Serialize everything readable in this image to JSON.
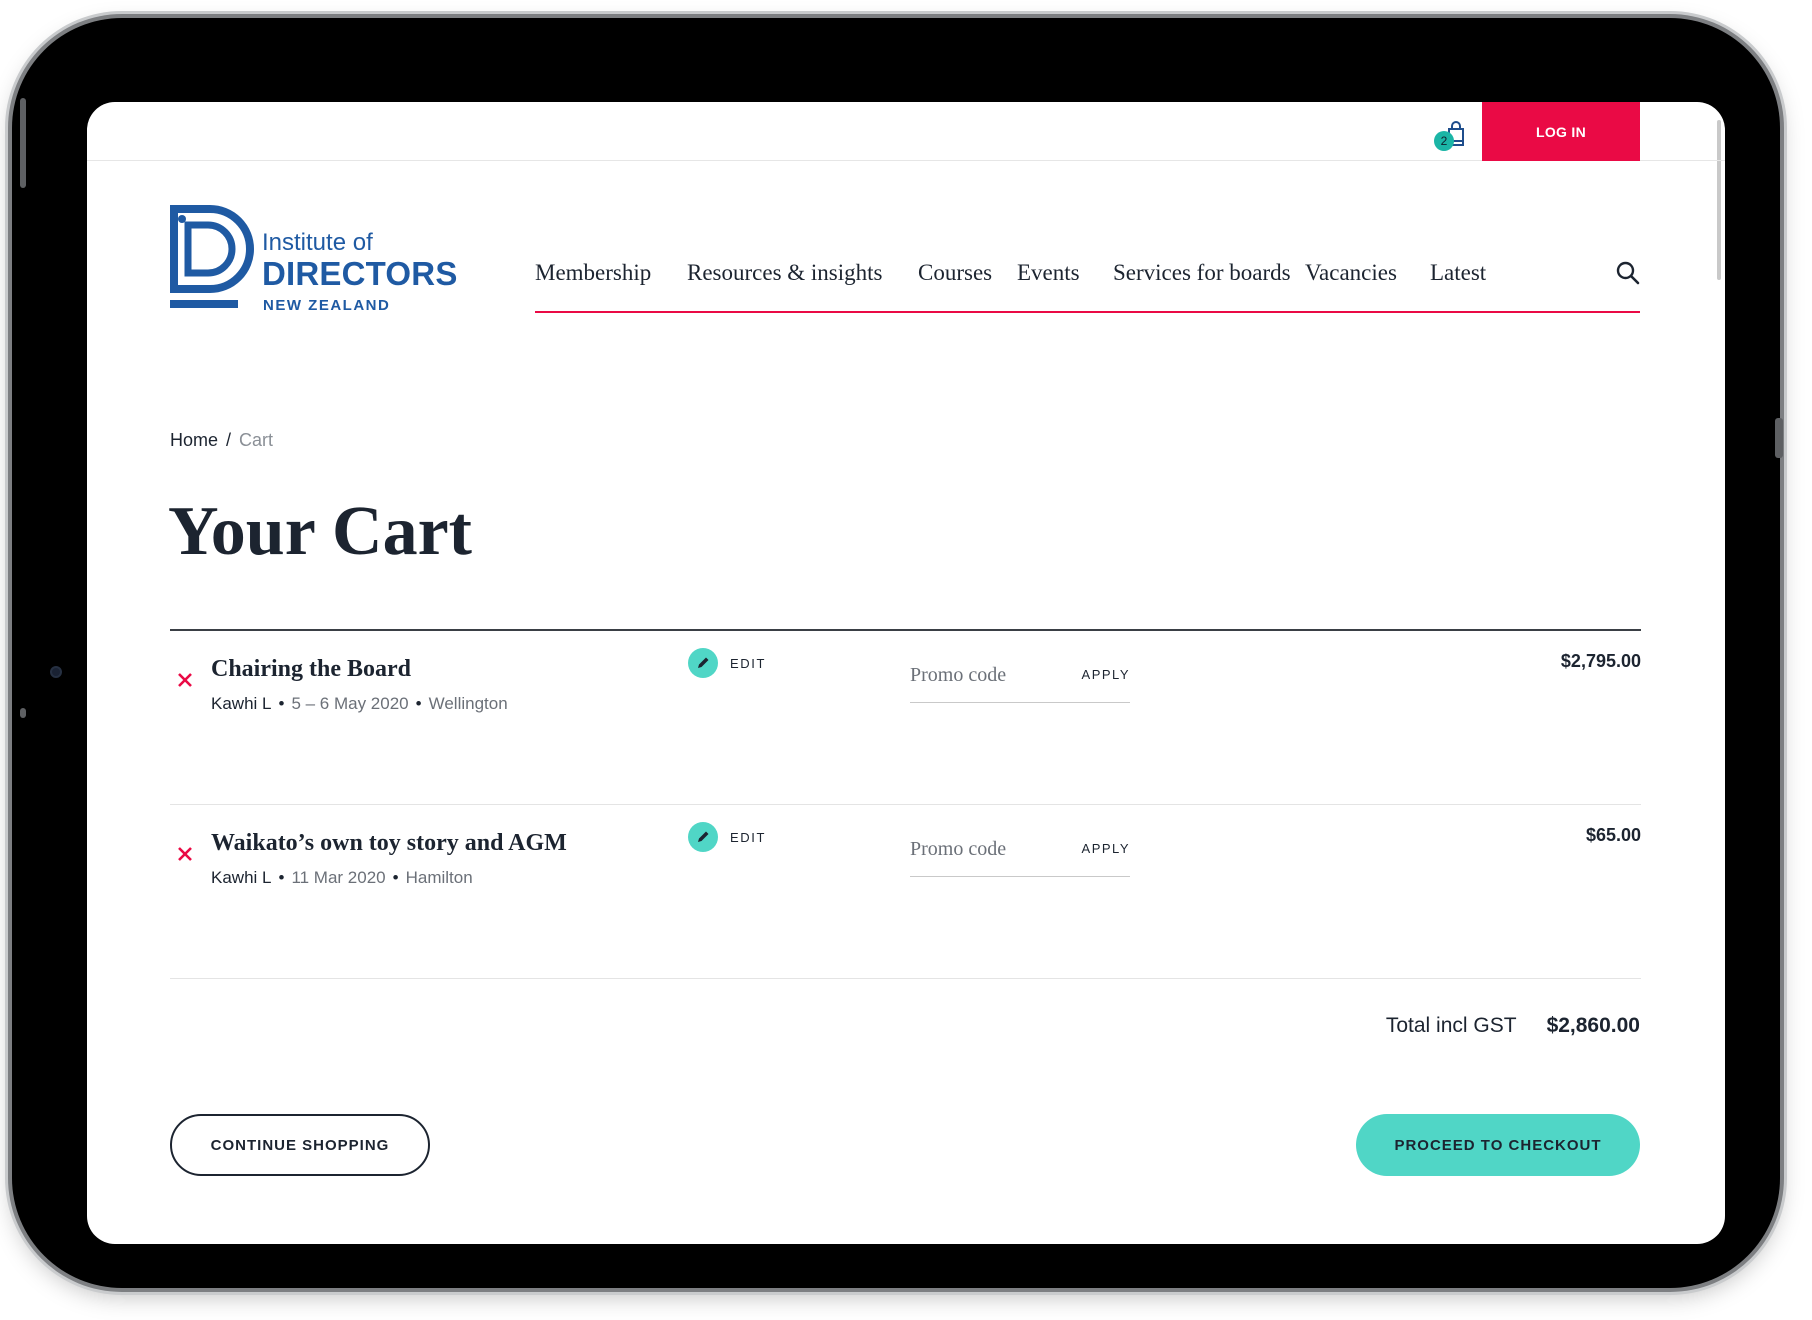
{
  "header": {
    "cart_count": "2",
    "login_label": "LOG IN"
  },
  "logo": {
    "line1": "Institute of",
    "line2": "DIRECTORS",
    "line3": "NEW ZEALAND"
  },
  "nav": {
    "items": [
      {
        "label": "Membership"
      },
      {
        "label": "Resources & insights"
      },
      {
        "label": "Courses"
      },
      {
        "label": "Events"
      },
      {
        "label": "Services for boards"
      },
      {
        "label": "Vacancies"
      },
      {
        "label": "Latest"
      }
    ]
  },
  "breadcrumb": {
    "home": "Home",
    "separator": "/",
    "current": "Cart"
  },
  "page": {
    "title": "Your Cart"
  },
  "cart": {
    "items": [
      {
        "title": "Chairing the Board",
        "attendee": "Kawhi L",
        "date": "5 – 6 May 2020",
        "location": "Wellington",
        "edit_label": "EDIT",
        "promo_placeholder": "Promo code",
        "apply_label": "APPLY",
        "price": "$2,795.00"
      },
      {
        "title": "Waikato’s own toy story and AGM",
        "attendee": "Kawhi L",
        "date": "11 Mar 2020",
        "location": "Hamilton",
        "edit_label": "EDIT",
        "promo_placeholder": "Promo code",
        "apply_label": "APPLY",
        "price": "$65.00"
      }
    ],
    "total_label": "Total incl GST",
    "total_value": "$2,860.00"
  },
  "actions": {
    "continue_label": "CONTINUE SHOPPING",
    "checkout_label": "PROCEED TO CHECKOUT"
  },
  "colors": {
    "accent_red": "#ea0a45",
    "accent_teal": "#50d6c6",
    "brand_blue": "#1f5aa3",
    "text_dark": "#1c2430"
  },
  "icons": {
    "cart": "shopping-bag-icon",
    "search": "search-icon",
    "remove": "close-icon",
    "edit": "pencil-icon"
  }
}
